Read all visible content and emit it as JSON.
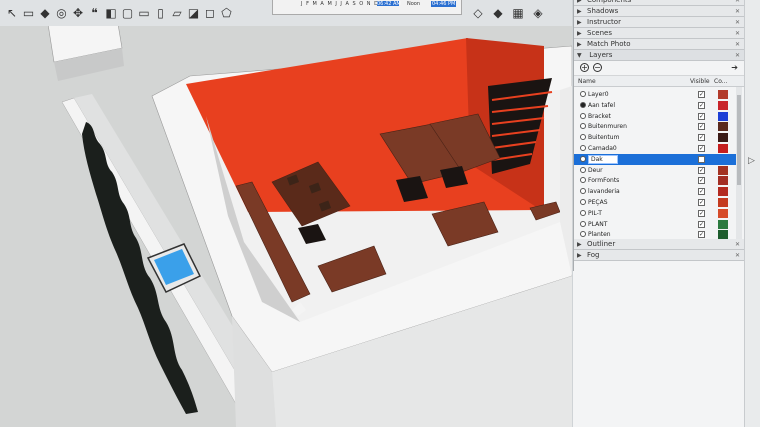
{
  "toolbar": {
    "tools": [
      {
        "name": "select-icon",
        "glyph": "↖"
      },
      {
        "name": "eraser-icon",
        "glyph": "▭"
      },
      {
        "name": "paint-bucket-icon",
        "glyph": "◆"
      },
      {
        "name": "orbit-icon",
        "glyph": "◎"
      },
      {
        "name": "pan-icon",
        "glyph": "✥"
      },
      {
        "name": "footprints-icon",
        "glyph": "❝"
      },
      {
        "name": "iso-view-icon",
        "glyph": "◧"
      },
      {
        "name": "top-view-icon",
        "glyph": "▢"
      },
      {
        "name": "front-view-icon",
        "glyph": "▭"
      },
      {
        "name": "right-view-icon",
        "glyph": "▯"
      },
      {
        "name": "back-view-icon",
        "glyph": "▱"
      },
      {
        "name": "left-view-icon",
        "glyph": "◪"
      },
      {
        "name": "xray-style-icon",
        "glyph": "◻"
      },
      {
        "name": "wireframe-style-icon",
        "glyph": "⬠"
      },
      {
        "name": "hidden-line-style-icon",
        "glyph": "◇"
      },
      {
        "name": "shaded-style-icon",
        "glyph": "◆"
      },
      {
        "name": "textured-style-icon",
        "glyph": "▦"
      },
      {
        "name": "monochrome-style-icon",
        "glyph": "◈"
      }
    ],
    "shadow_settings": {
      "months": "J F M A M J J A S O N D",
      "time_start": "06:42 AM",
      "noon": "Noon",
      "time_end": "04:46 PM"
    }
  },
  "tray": {
    "panels_top": [
      {
        "label": "Components"
      },
      {
        "label": "Shadows"
      },
      {
        "label": "Instructor"
      },
      {
        "label": "Scenes"
      },
      {
        "label": "Match Photo"
      }
    ],
    "layers_panel": {
      "label": "Layers",
      "add_glyph": "+",
      "remove_glyph": "−",
      "details_glyph": "➔",
      "col_name": "Name",
      "col_visible": "Visible",
      "col_color": "Co...",
      "rows": [
        {
          "name": "Layer0",
          "active": false,
          "visible": true,
          "color": "#b23a2a",
          "selected": false
        },
        {
          "name": "Aan tafel",
          "active": true,
          "visible": true,
          "color": "#c8242a",
          "selected": false
        },
        {
          "name": "Bracket",
          "active": false,
          "visible": true,
          "color": "#1d3fd6",
          "selected": false
        },
        {
          "name": "Buitenmuren",
          "active": false,
          "visible": true,
          "color": "#5a2a1e",
          "selected": false
        },
        {
          "name": "Buitentum",
          "active": false,
          "visible": true,
          "color": "#3a1a16",
          "selected": false
        },
        {
          "name": "Camada0",
          "active": false,
          "visible": true,
          "color": "#c41e1e",
          "selected": false
        },
        {
          "name": "Dak",
          "active": false,
          "visible": false,
          "color": "#1b6fd8",
          "selected": true
        },
        {
          "name": "Deur",
          "active": false,
          "visible": true,
          "color": "#a33222",
          "selected": false
        },
        {
          "name": "FormFonts",
          "active": false,
          "visible": true,
          "color": "#a32e24",
          "selected": false
        },
        {
          "name": "lavanderia",
          "active": false,
          "visible": true,
          "color": "#b32a20",
          "selected": false
        },
        {
          "name": "PEÇAS",
          "active": false,
          "visible": true,
          "color": "#c43a1f",
          "selected": false
        },
        {
          "name": "PIL-T",
          "active": false,
          "visible": true,
          "color": "#d64b2a",
          "selected": false
        },
        {
          "name": "PLANT",
          "active": false,
          "visible": true,
          "color": "#2b7a3f",
          "selected": false
        },
        {
          "name": "Planten",
          "active": false,
          "visible": true,
          "color": "#1e5d2e",
          "selected": false
        }
      ]
    },
    "panels_bottom": [
      {
        "label": "Outliner"
      },
      {
        "label": "Fog"
      }
    ]
  },
  "viewport": {
    "accent_wall": "#e8401f",
    "floor": "#f1f1f1",
    "furniture": "#7a3a26",
    "pool": "#3aa0ea",
    "hedge": "#1b1f1c",
    "wall_top": "#f6f6f6"
  }
}
